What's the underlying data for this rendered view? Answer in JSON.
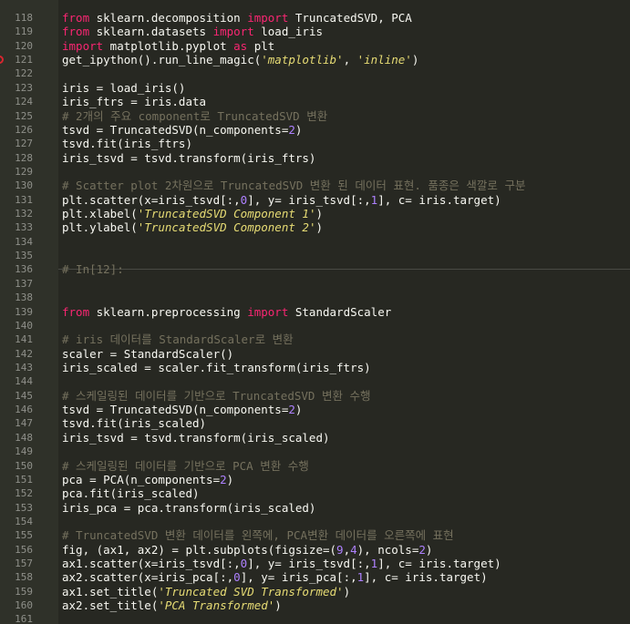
{
  "editor": {
    "breakpoint_line": 121,
    "cell_separator_line": 136,
    "lines": [
      {
        "n": "118",
        "tokens": [
          {
            "t": "from",
            "c": "kw"
          },
          {
            "t": " sklearn.decomposition "
          },
          {
            "t": "import",
            "c": "kw"
          },
          {
            "t": " TruncatedSVD, PCA"
          }
        ]
      },
      {
        "n": "119",
        "tokens": [
          {
            "t": "from",
            "c": "kw"
          },
          {
            "t": " sklearn.datasets "
          },
          {
            "t": "import",
            "c": "kw"
          },
          {
            "t": " load_iris"
          }
        ]
      },
      {
        "n": "120",
        "tokens": [
          {
            "t": "import",
            "c": "kw"
          },
          {
            "t": " matplotlib.pyplot "
          },
          {
            "t": "as",
            "c": "kw"
          },
          {
            "t": " plt"
          }
        ]
      },
      {
        "n": "121",
        "tokens": [
          {
            "t": "get_ipython().run_line_magic("
          },
          {
            "t": "'matplotlib'",
            "c": "str"
          },
          {
            "t": ", "
          },
          {
            "t": "'inline'",
            "c": "str"
          },
          {
            "t": ")"
          }
        ]
      },
      {
        "n": "122",
        "tokens": []
      },
      {
        "n": "123",
        "tokens": [
          {
            "t": "iris = load_iris()"
          }
        ]
      },
      {
        "n": "124",
        "tokens": [
          {
            "t": "iris_ftrs = iris.data"
          }
        ]
      },
      {
        "n": "125",
        "tokens": [
          {
            "t": "# 2개의 주요 component로 TruncatedSVD 변환",
            "c": "cm"
          }
        ]
      },
      {
        "n": "126",
        "tokens": [
          {
            "t": "tsvd = TruncatedSVD(n_components="
          },
          {
            "t": "2",
            "c": "num"
          },
          {
            "t": ")"
          }
        ]
      },
      {
        "n": "127",
        "tokens": [
          {
            "t": "tsvd.fit(iris_ftrs)"
          }
        ]
      },
      {
        "n": "128",
        "tokens": [
          {
            "t": "iris_tsvd = tsvd.transform(iris_ftrs)"
          }
        ]
      },
      {
        "n": "129",
        "tokens": []
      },
      {
        "n": "130",
        "tokens": [
          {
            "t": "# Scatter plot 2차원으로 TruncatedSVD 변환 된 데이터 표현. 품종은 색깔로 구분",
            "c": "cm"
          }
        ]
      },
      {
        "n": "131",
        "tokens": [
          {
            "t": "plt.scatter(x=iris_tsvd[:,"
          },
          {
            "t": "0",
            "c": "num"
          },
          {
            "t": "], y= iris_tsvd[:,"
          },
          {
            "t": "1",
            "c": "num"
          },
          {
            "t": "], c= iris.target)"
          }
        ]
      },
      {
        "n": "132",
        "tokens": [
          {
            "t": "plt.xlabel("
          },
          {
            "t": "'TruncatedSVD Component 1'",
            "c": "str"
          },
          {
            "t": ")"
          }
        ]
      },
      {
        "n": "133",
        "tokens": [
          {
            "t": "plt.ylabel("
          },
          {
            "t": "'TruncatedSVD Component 2'",
            "c": "str"
          },
          {
            "t": ")"
          }
        ]
      },
      {
        "n": "134",
        "tokens": []
      },
      {
        "n": "135",
        "tokens": []
      },
      {
        "n": "136",
        "tokens": [
          {
            "t": "# In[12]:",
            "c": "cm"
          }
        ]
      },
      {
        "n": "137",
        "tokens": []
      },
      {
        "n": "138",
        "tokens": []
      },
      {
        "n": "139",
        "tokens": [
          {
            "t": "from",
            "c": "kw"
          },
          {
            "t": " sklearn.preprocessing "
          },
          {
            "t": "import",
            "c": "kw"
          },
          {
            "t": " StandardScaler"
          }
        ]
      },
      {
        "n": "140",
        "tokens": []
      },
      {
        "n": "141",
        "tokens": [
          {
            "t": "# iris 데이터를 StandardScaler로 변환",
            "c": "cm"
          }
        ]
      },
      {
        "n": "142",
        "tokens": [
          {
            "t": "scaler = StandardScaler()"
          }
        ]
      },
      {
        "n": "143",
        "tokens": [
          {
            "t": "iris_scaled = scaler.fit_transform(iris_ftrs)"
          }
        ]
      },
      {
        "n": "144",
        "tokens": []
      },
      {
        "n": "145",
        "tokens": [
          {
            "t": "# 스케일링된 데이터를 기반으로 TruncatedSVD 변환 수행",
            "c": "cm"
          }
        ]
      },
      {
        "n": "146",
        "tokens": [
          {
            "t": "tsvd = TruncatedSVD(n_components="
          },
          {
            "t": "2",
            "c": "num"
          },
          {
            "t": ")"
          }
        ]
      },
      {
        "n": "147",
        "tokens": [
          {
            "t": "tsvd.fit(iris_scaled)"
          }
        ]
      },
      {
        "n": "148",
        "tokens": [
          {
            "t": "iris_tsvd = tsvd.transform(iris_scaled)"
          }
        ]
      },
      {
        "n": "149",
        "tokens": []
      },
      {
        "n": "150",
        "tokens": [
          {
            "t": "# 스케일링된 데이터를 기반으로 PCA 변환 수행",
            "c": "cm"
          }
        ]
      },
      {
        "n": "151",
        "tokens": [
          {
            "t": "pca = PCA(n_components="
          },
          {
            "t": "2",
            "c": "num"
          },
          {
            "t": ")"
          }
        ]
      },
      {
        "n": "152",
        "tokens": [
          {
            "t": "pca.fit(iris_scaled)"
          }
        ]
      },
      {
        "n": "153",
        "tokens": [
          {
            "t": "iris_pca = pca.transform(iris_scaled)"
          }
        ]
      },
      {
        "n": "154",
        "tokens": []
      },
      {
        "n": "155",
        "tokens": [
          {
            "t": "# TruncatedSVD 변환 데이터를 왼쪽에, PCA변환 데이터를 오른쪽에 표현",
            "c": "cm"
          }
        ]
      },
      {
        "n": "156",
        "tokens": [
          {
            "t": "fig, (ax1, ax2) = plt.subplots(figsize=("
          },
          {
            "t": "9",
            "c": "num"
          },
          {
            "t": ","
          },
          {
            "t": "4",
            "c": "num"
          },
          {
            "t": "), ncols="
          },
          {
            "t": "2",
            "c": "num"
          },
          {
            "t": ")"
          }
        ]
      },
      {
        "n": "157",
        "tokens": [
          {
            "t": "ax1.scatter(x=iris_tsvd[:,"
          },
          {
            "t": "0",
            "c": "num"
          },
          {
            "t": "], y= iris_tsvd[:,"
          },
          {
            "t": "1",
            "c": "num"
          },
          {
            "t": "], c= iris.target)"
          }
        ]
      },
      {
        "n": "158",
        "tokens": [
          {
            "t": "ax2.scatter(x=iris_pca[:,"
          },
          {
            "t": "0",
            "c": "num"
          },
          {
            "t": "], y= iris_pca[:,"
          },
          {
            "t": "1",
            "c": "num"
          },
          {
            "t": "], c= iris.target)"
          }
        ]
      },
      {
        "n": "159",
        "tokens": [
          {
            "t": "ax1.set_title("
          },
          {
            "t": "'Truncated SVD Transformed'",
            "c": "str"
          },
          {
            "t": ")"
          }
        ]
      },
      {
        "n": "160",
        "tokens": [
          {
            "t": "ax2.set_title("
          },
          {
            "t": "'PCA Transformed'",
            "c": "str"
          },
          {
            "t": ")"
          }
        ]
      },
      {
        "n": "161",
        "tokens": []
      }
    ]
  },
  "colors": {
    "background": "#272822",
    "gutter": "#2f3129",
    "keyword": "#f92672",
    "string": "#e6db74",
    "number": "#ae81ff",
    "comment": "#75715e",
    "text": "#f8f8f2",
    "breakpoint": "#d9262f"
  }
}
